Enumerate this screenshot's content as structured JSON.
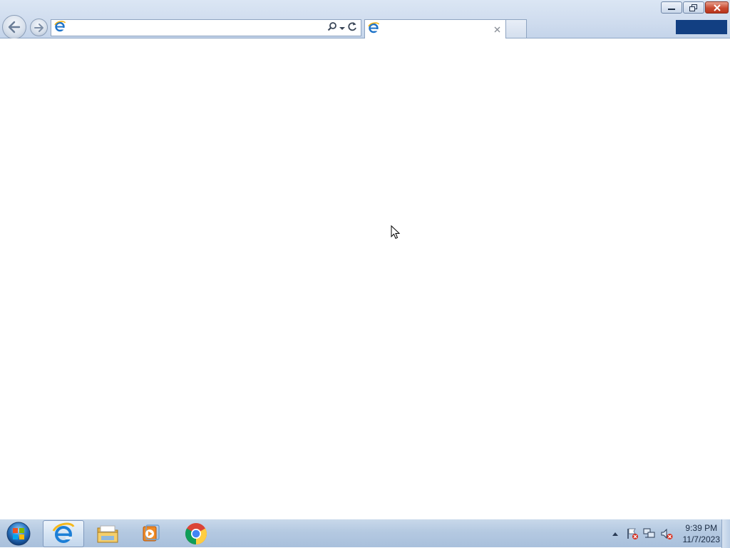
{
  "browser": {
    "address": {
      "value": "",
      "placeholder": ""
    },
    "tab": {
      "title": ""
    },
    "icons": {
      "back": "back-arrow-icon",
      "forward": "forward-arrow-icon",
      "page": "internet-explorer-icon",
      "search": "search-icon",
      "dropdown": "chevron-down-icon",
      "refresh": "refresh-icon",
      "tab_close": "close-icon"
    }
  },
  "window_controls": [
    "minimize",
    "restore",
    "close"
  ],
  "taskbar": {
    "pinned": [
      {
        "name": "internet-explorer",
        "active": true
      },
      {
        "name": "windows-explorer",
        "active": false
      },
      {
        "name": "media-player",
        "active": false
      },
      {
        "name": "google-chrome",
        "active": false
      }
    ],
    "tray": [
      "show-hidden-icons",
      "action-center-flag",
      "network",
      "volume-muted"
    ],
    "clock": {
      "time": "9:39 PM",
      "date": "11/7/2023"
    }
  },
  "colors": {
    "chrome": "#cfdcee",
    "taskbar": "#b4c9e1",
    "accent_dark": "#123f82",
    "close": "#c94b32"
  }
}
